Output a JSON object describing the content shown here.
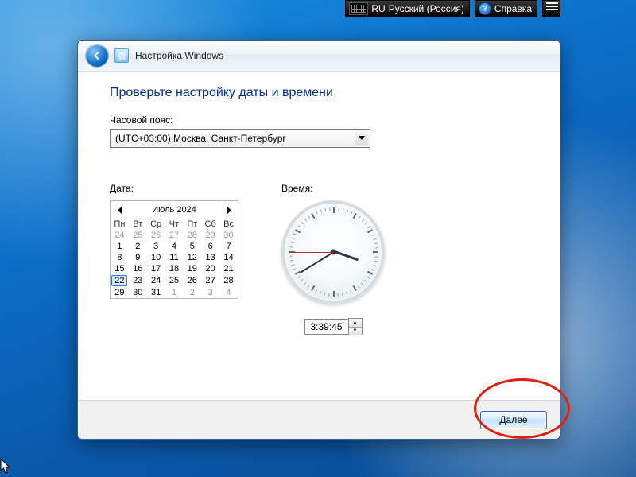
{
  "topbar": {
    "lang_code": "RU",
    "lang_name": "Русский (Россия)",
    "help_label": "Справка"
  },
  "window": {
    "title": "Настройка Windows",
    "heading": "Проверьте настройку даты и времени",
    "tz_label": "Часовой пояс:",
    "tz_value": "(UTC+03:00) Москва, Санкт-Петербург",
    "date_label": "Дата:",
    "time_label": "Время:",
    "next_label": "Далее"
  },
  "calendar": {
    "title": "Июль 2024",
    "weekdays": [
      "Пн",
      "Вт",
      "Ср",
      "Чт",
      "Пт",
      "Сб",
      "Вс"
    ],
    "rows": [
      [
        {
          "d": 24,
          "dim": true
        },
        {
          "d": 25,
          "dim": true
        },
        {
          "d": 26,
          "dim": true
        },
        {
          "d": 27,
          "dim": true
        },
        {
          "d": 28,
          "dim": true
        },
        {
          "d": 29,
          "dim": true
        },
        {
          "d": 30,
          "dim": true
        }
      ],
      [
        {
          "d": 1
        },
        {
          "d": 2
        },
        {
          "d": 3
        },
        {
          "d": 4
        },
        {
          "d": 5
        },
        {
          "d": 6
        },
        {
          "d": 7
        }
      ],
      [
        {
          "d": 8
        },
        {
          "d": 9
        },
        {
          "d": 10
        },
        {
          "d": 11
        },
        {
          "d": 12
        },
        {
          "d": 13
        },
        {
          "d": 14
        }
      ],
      [
        {
          "d": 15
        },
        {
          "d": 16
        },
        {
          "d": 17
        },
        {
          "d": 18
        },
        {
          "d": 19
        },
        {
          "d": 20
        },
        {
          "d": 21
        }
      ],
      [
        {
          "d": 22,
          "sel": true
        },
        {
          "d": 23
        },
        {
          "d": 24
        },
        {
          "d": 25
        },
        {
          "d": 26
        },
        {
          "d": 27
        },
        {
          "d": 28
        }
      ],
      [
        {
          "d": 29
        },
        {
          "d": 30
        },
        {
          "d": 31
        },
        {
          "d": 1,
          "dim": true
        },
        {
          "d": 2,
          "dim": true
        },
        {
          "d": 3,
          "dim": true
        },
        {
          "d": 4,
          "dim": true
        }
      ]
    ]
  },
  "clock": {
    "time_text": "3:39:45",
    "hours": 3,
    "minutes": 39,
    "seconds": 45
  }
}
